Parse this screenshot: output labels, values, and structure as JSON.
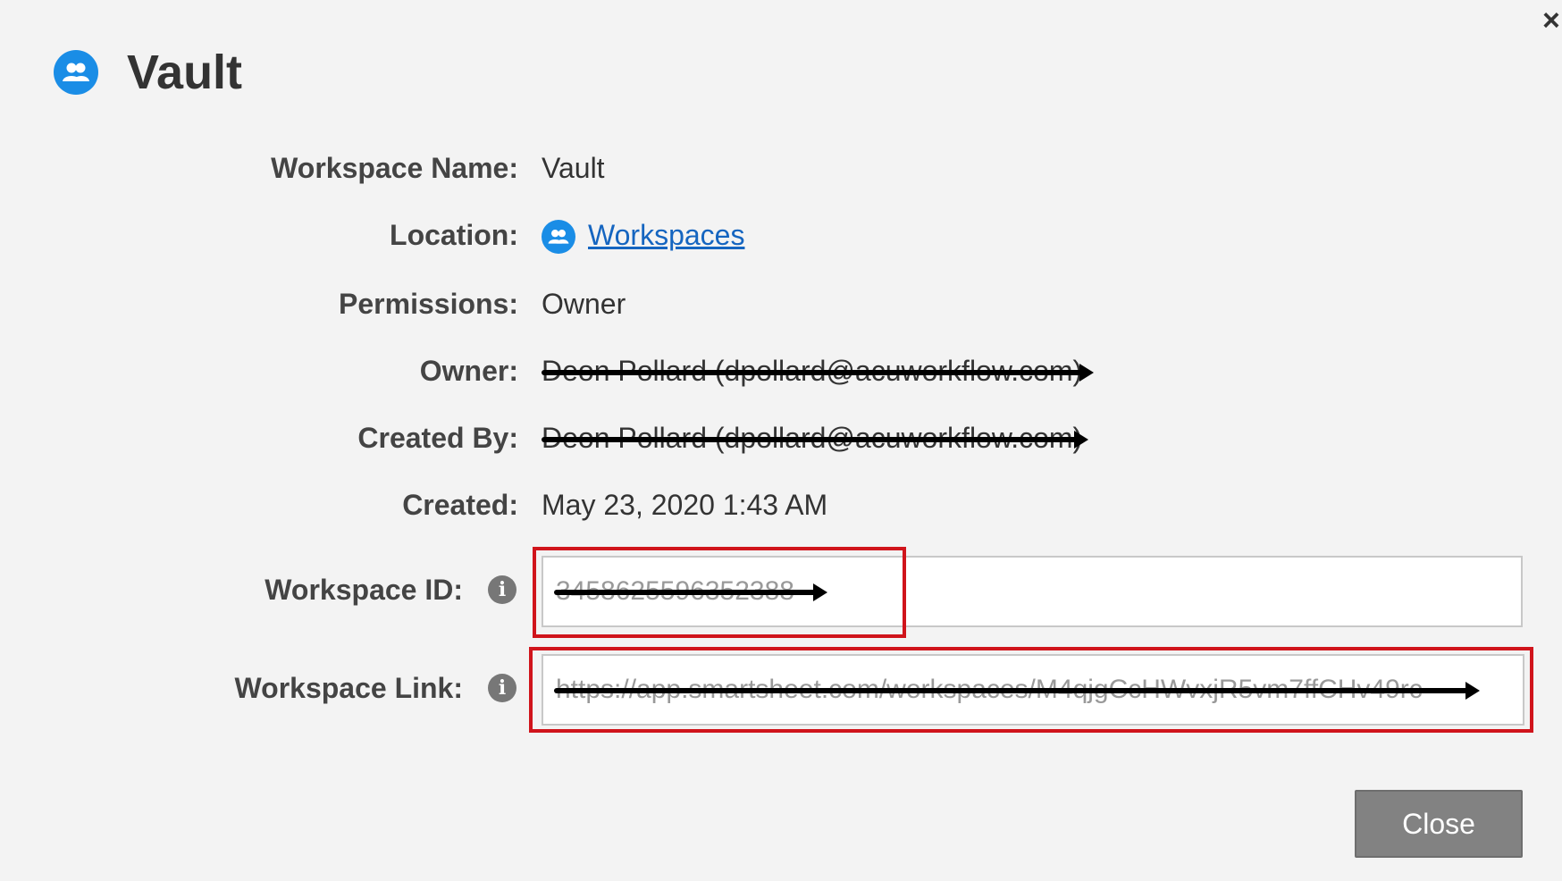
{
  "dialog": {
    "title": "Vault",
    "close_glyph": "×",
    "header_icon": "workspace-icon",
    "fields": {
      "workspace_name": {
        "label": "Workspace Name:",
        "value": "Vault"
      },
      "location": {
        "label": "Location:",
        "value": "Workspaces",
        "icon": "workspace-icon"
      },
      "permissions": {
        "label": "Permissions:",
        "value": "Owner"
      },
      "owner": {
        "label": "Owner:",
        "value": "Deon Pollard (dpollard@acuworkflow.com)"
      },
      "created_by": {
        "label": "Created By:",
        "value": "Deon Pollard (dpollard@acuworkflow.com)"
      },
      "created": {
        "label": "Created:",
        "value": "May 23, 2020 1:43 AM"
      },
      "workspace_id": {
        "label": "Workspace ID:",
        "value": "3458625596352388",
        "info_icon": "i"
      },
      "workspace_link": {
        "label": "Workspace Link:",
        "value": "https://app.smartsheet.com/workspaces/M4qjgCcHWvxjR5vm7ffCHv49rc",
        "info_icon": "i"
      }
    },
    "close_button_label": "Close",
    "colors": {
      "accent": "#1a8de6",
      "link": "#1565c0",
      "highlight": "#d0141b",
      "button": "#828282"
    }
  }
}
